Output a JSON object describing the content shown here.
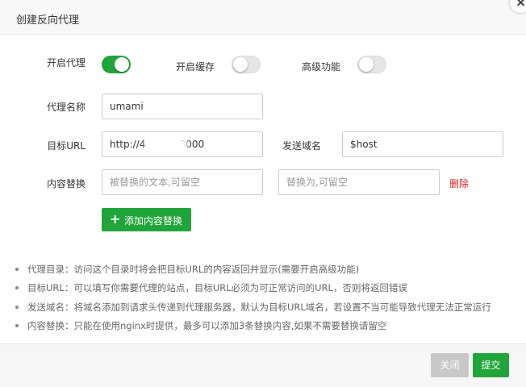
{
  "dialog": {
    "title": "创建反向代理"
  },
  "toggles": [
    {
      "label": "开启代理",
      "on": true
    },
    {
      "label": "开启缓存",
      "on": false
    },
    {
      "label": "高级功能",
      "on": false
    }
  ],
  "form": {
    "name_label": "代理名称",
    "name_value": "umami",
    "target_label": "目标URL",
    "target_value": "http://4          :3000",
    "domain_label": "发送域名",
    "domain_value": "$host",
    "replace_label": "内容替换",
    "replace_from_placeholder": "被替换的文本,可留空",
    "replace_to_placeholder": "替换为,可留空",
    "delete_label": "删除",
    "add_button_label": "添加内容替换"
  },
  "tips": [
    "代理目录：访问这个目录时将会把目标URL的内容返回并显示(需要开启高级功能)",
    "目标URL：可以填写你需要代理的站点，目标URL必须为可正常访问的URL，否则将返回错误",
    "发送域名：将域名添加到请求头传递到代理服务器，默认为目标URL域名，若设置不当可能导致代理无法正常运行",
    "内容替换：只能在使用nginx时提供，最多可以添加3条替换内容,如果不需要替换请留空"
  ],
  "footer": {
    "close_label": "关闭",
    "submit_label": "提交"
  },
  "colors": {
    "accent": "#20a53a",
    "danger": "#e02020",
    "disabled": "#c8c8c8"
  }
}
